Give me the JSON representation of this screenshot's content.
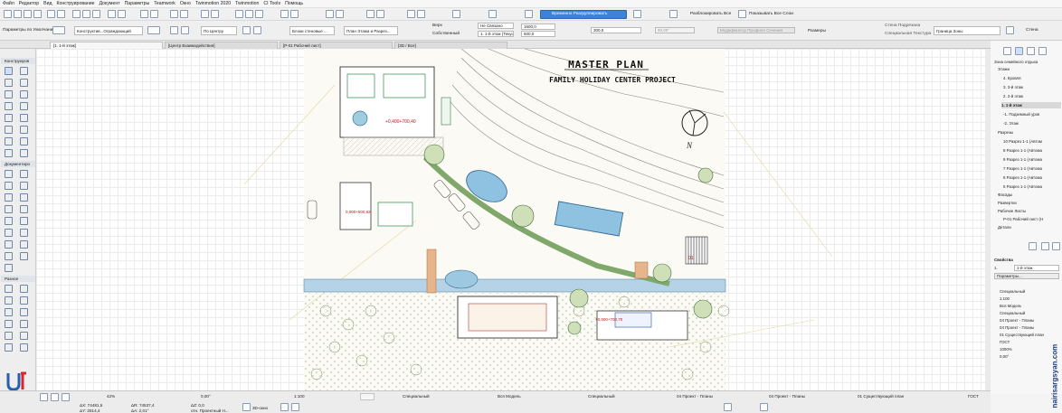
{
  "menu": [
    "Файл",
    "Редактор",
    "Вид",
    "Конструирование",
    "Документ",
    "Параметры",
    "Teamwork",
    "Окно",
    "Twinmotion 2020",
    "Twinmotion",
    "CI Tools",
    "Помощь"
  ],
  "toolbar": {
    "temp_unlock": "Временно Разгруппировать",
    "unlock_all": "Разблокировать Все",
    "show_all_layers": "Показывать Все Слои"
  },
  "infobox": {
    "label": "Параметры по Умолчанию",
    "construct": "Конструктив...Ограждающий",
    "by_center": "По Центру",
    "blocks": "Блоки стеновые ...",
    "plan_floor": "План Этажа и Разрез...",
    "top_label": "Верх",
    "top_value": "Не Связано",
    "home_floor": "1. 1-й этаж (Текущий)",
    "own": "Собственный",
    "height": "1600,0",
    "thickness": "600,0",
    "offset": "300,0",
    "angle": "90,00°",
    "modifier": "Модификатор Профиля Сечения",
    "sizes": "Размеры",
    "wall_cover": "Стена Подрезана",
    "special_texture": "Специальная Текстура",
    "zone_border": "Граница Зоны",
    "wall_tool": "Стена"
  },
  "tabs": [
    {
      "label": "[1. 1-й этаж]"
    },
    {
      "label": "[Центр Взаимодействия]"
    },
    {
      "label": "[Р-01 Рабочий лист]"
    },
    {
      "label": "[3D / Все]"
    }
  ],
  "toolbox": {
    "constructs": "Конструиров",
    "document": "Документиро",
    "misc": "Разное"
  },
  "drawing": {
    "title": "MASTER PLAN",
    "subtitle": "FAMILY HOLIDAY CENTER PROJECT",
    "north": "N",
    "level1": "+0,400+700,40",
    "level2": "0,000+500,82",
    "level3": "+0,900+700,70",
    "label_01": "01"
  },
  "navigator": {
    "root": "Зона семейного отдыха",
    "floors_group": "Этажи",
    "floors": [
      "4. Кровля",
      "3. 3-й этаж",
      "2. 2-й этаж",
      "1. 1-й этаж",
      "-1. Подземный уров",
      "-2. Этаж"
    ],
    "sections_group": "Разрезы",
    "sections": [
      "10 Разрез 1-1 (Автом",
      "8 Разрез 1-1 (Автома",
      "9 Разрез 1-1 (Автома",
      "7 Разрез 1-1 (Автома",
      "6 Разрез 1-1 (Автома",
      "5 Разрез 1-1 (Автома"
    ],
    "facades": "Фасады",
    "sweeps": "Развертки",
    "worksheets_group": "Рабочие Листы",
    "worksheet": "Р-01 Рабочий лист (Н",
    "details": "Детали"
  },
  "properties": {
    "title": "Свойства",
    "num": "1.",
    "name": "1-й этаж",
    "params": "Параметры...",
    "list": [
      "Специальный",
      "1:100",
      "Вся Модель",
      "Специальный",
      "04 Проект - Планы",
      "04 Проект - Планы",
      "01 Существующий план",
      "ГОСТ",
      "1000%",
      "0,00°"
    ]
  },
  "status": {
    "zoom": "42%",
    "angle": "0,00°",
    "scale": "1:100",
    "coord_x": "ΔX: 74481,5",
    "coord_y": "ΔY: 2814,4",
    "coord_r": "ΔR: 74537,4",
    "coord_a": "ΔA: 2,01°",
    "coord_z": "ΔZ: 0,0",
    "ref": "отн. Проектный Н...",
    "view3d": "3D-окно",
    "layer_combo": "Специальный",
    "model": "Вся Модель",
    "pen": "Специальный",
    "plans1": "04 Проект - Планы",
    "plans2": "04 Проект - Планы",
    "existing": "01 Существующий план",
    "gost": "ГОСТ"
  },
  "watermark": "nairisargsyan.com"
}
